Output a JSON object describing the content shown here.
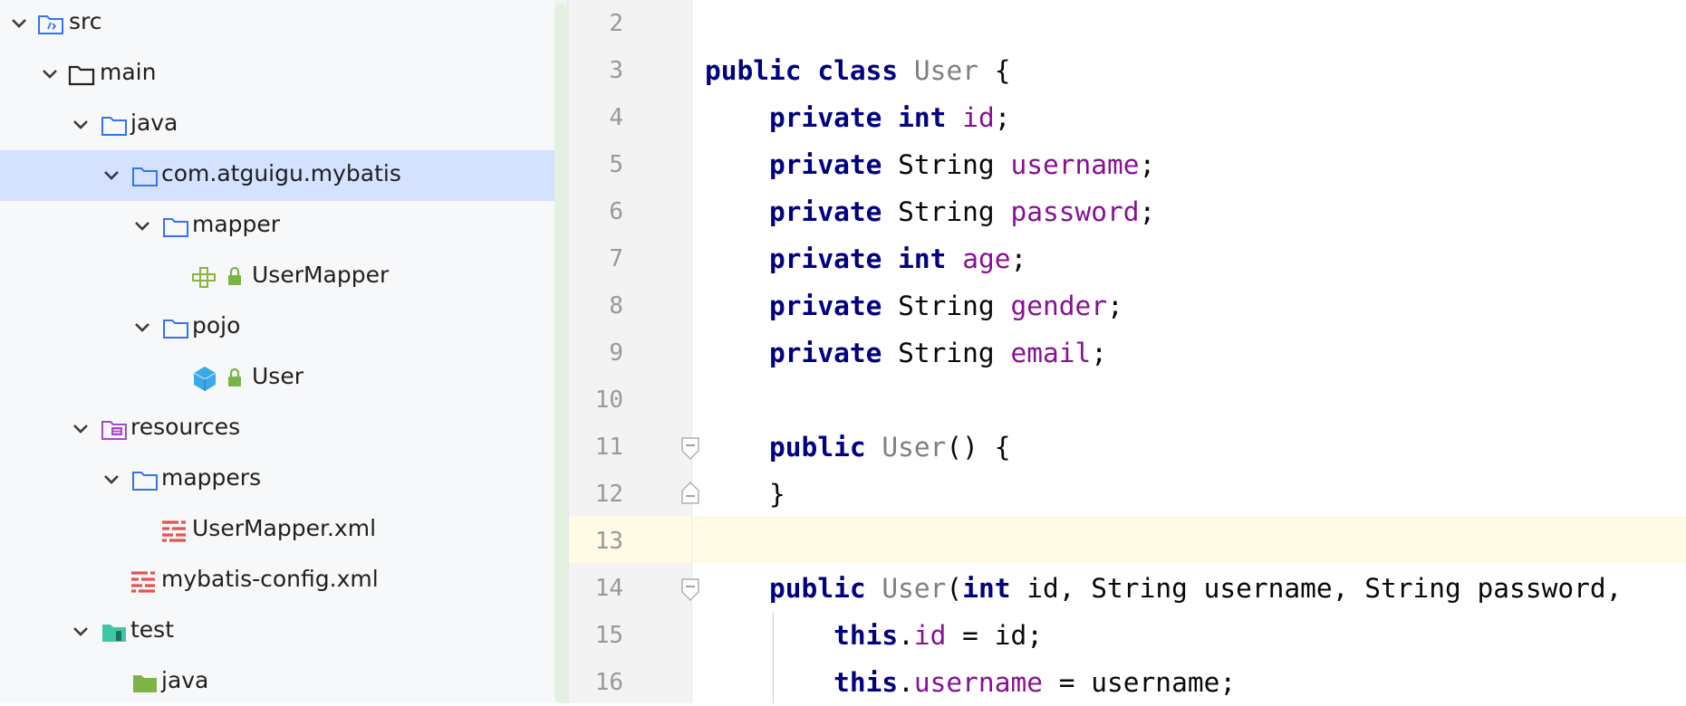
{
  "tree": {
    "items": [
      {
        "label": "src",
        "expanded": true,
        "icon": "source-folder-icon"
      },
      {
        "label": "main",
        "expanded": true,
        "icon": "folder-icon"
      },
      {
        "label": "java",
        "expanded": true,
        "icon": "source-folder-icon"
      },
      {
        "label": "com.atguigu.mybatis",
        "expanded": true,
        "icon": "package-folder-icon",
        "selected": true
      },
      {
        "label": "mapper",
        "expanded": true,
        "icon": "package-folder-icon"
      },
      {
        "label": "UserMapper",
        "icon": "interface-icon",
        "locked": true
      },
      {
        "label": "pojo",
        "expanded": true,
        "icon": "package-folder-icon"
      },
      {
        "label": "User",
        "icon": "class-icon",
        "locked": true
      },
      {
        "label": "resources",
        "expanded": true,
        "icon": "resources-folder-icon"
      },
      {
        "label": "mappers",
        "expanded": true,
        "icon": "package-folder-icon"
      },
      {
        "label": "UserMapper.xml",
        "icon": "xml-file-icon"
      },
      {
        "label": "mybatis-config.xml",
        "icon": "xml-file-icon"
      },
      {
        "label": "test",
        "expanded": true,
        "icon": "test-folder-icon"
      },
      {
        "label": "java",
        "icon": "test-source-folder-icon"
      }
    ]
  },
  "editor": {
    "current_line": "13",
    "lines": [
      {
        "num": "2",
        "indent": "",
        "tokens": []
      },
      {
        "num": "3",
        "indent": "",
        "tokens": [
          {
            "t": "public",
            "c": "kw2"
          },
          {
            "t": " "
          },
          {
            "t": "class",
            "c": "kw2"
          },
          {
            "t": " "
          },
          {
            "t": "User",
            "c": "cls"
          },
          {
            "t": " {"
          }
        ]
      },
      {
        "num": "4",
        "indent": "    ",
        "tokens": [
          {
            "t": "private",
            "c": "kw2"
          },
          {
            "t": " "
          },
          {
            "t": "int",
            "c": "kw2"
          },
          {
            "t": " "
          },
          {
            "t": "id",
            "c": "fld"
          },
          {
            "t": ";"
          }
        ]
      },
      {
        "num": "5",
        "indent": "    ",
        "tokens": [
          {
            "t": "private",
            "c": "kw2"
          },
          {
            "t": " String "
          },
          {
            "t": "username",
            "c": "fld"
          },
          {
            "t": ";"
          }
        ]
      },
      {
        "num": "6",
        "indent": "    ",
        "tokens": [
          {
            "t": "private",
            "c": "kw2"
          },
          {
            "t": " String "
          },
          {
            "t": "password",
            "c": "fld"
          },
          {
            "t": ";"
          }
        ]
      },
      {
        "num": "7",
        "indent": "    ",
        "tokens": [
          {
            "t": "private",
            "c": "kw2"
          },
          {
            "t": " "
          },
          {
            "t": "int",
            "c": "kw2"
          },
          {
            "t": " "
          },
          {
            "t": "age",
            "c": "fld"
          },
          {
            "t": ";"
          }
        ]
      },
      {
        "num": "8",
        "indent": "    ",
        "tokens": [
          {
            "t": "private",
            "c": "kw2"
          },
          {
            "t": " String "
          },
          {
            "t": "gender",
            "c": "fld"
          },
          {
            "t": ";"
          }
        ]
      },
      {
        "num": "9",
        "indent": "    ",
        "tokens": [
          {
            "t": "private",
            "c": "kw2"
          },
          {
            "t": " String "
          },
          {
            "t": "email",
            "c": "fld"
          },
          {
            "t": ";"
          }
        ]
      },
      {
        "num": "10",
        "indent": "",
        "tokens": []
      },
      {
        "num": "11",
        "indent": "    ",
        "tokens": [
          {
            "t": "public",
            "c": "kw2"
          },
          {
            "t": " "
          },
          {
            "t": "User",
            "c": "cls"
          },
          {
            "t": "() {"
          }
        ]
      },
      {
        "num": "12",
        "indent": "    ",
        "tokens": [
          {
            "t": "}"
          }
        ]
      },
      {
        "num": "13",
        "indent": "",
        "tokens": []
      },
      {
        "num": "14",
        "indent": "    ",
        "tokens": [
          {
            "t": "public",
            "c": "kw2"
          },
          {
            "t": " "
          },
          {
            "t": "User",
            "c": "cls"
          },
          {
            "t": "("
          },
          {
            "t": "int",
            "c": "kw2"
          },
          {
            "t": " id, String username, String password,"
          }
        ]
      },
      {
        "num": "15",
        "indent": "        ",
        "tokens": [
          {
            "t": "this",
            "c": "kw2"
          },
          {
            "t": "."
          },
          {
            "t": "id",
            "c": "fld"
          },
          {
            "t": " = id;"
          }
        ]
      },
      {
        "num": "16",
        "indent": "        ",
        "tokens": [
          {
            "t": "this",
            "c": "kw2"
          },
          {
            "t": "."
          },
          {
            "t": "username",
            "c": "fld"
          },
          {
            "t": " = username;"
          }
        ]
      }
    ]
  }
}
